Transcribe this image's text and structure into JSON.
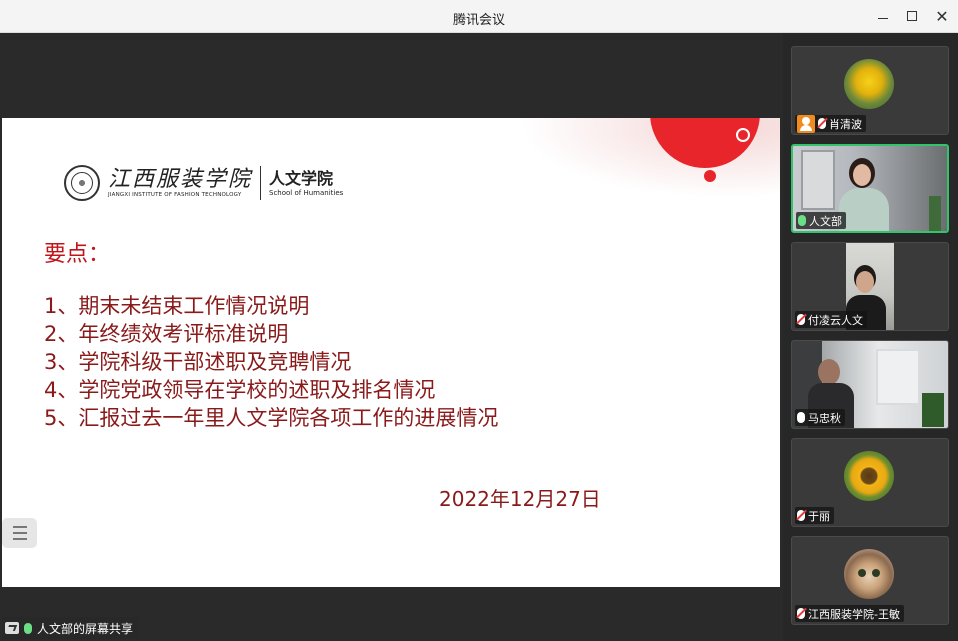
{
  "window": {
    "title": "腾讯会议"
  },
  "slide": {
    "school_name": "江西服装学院",
    "school_name_en": "JIANGXI INSTITUTE OF FASHION TECHNOLOGY",
    "department": "人文学院",
    "department_en": "School of Humanities",
    "heading": "要点：",
    "points": [
      "1、期末未结束工作情况说明",
      "2、年终绩效考评标准说明",
      "3、学院科级干部述职及竞聘情况",
      "4、学院党政领导在学校的述职及排名情况",
      "5、汇报过去一年里人文学院各项工作的进展情况"
    ],
    "date": "2022年12月27日"
  },
  "share_status": {
    "label": "人文部的屏幕共享"
  },
  "participants": [
    {
      "name": "肖清波",
      "mic": "muted",
      "host": true,
      "avatar": "dandelion-avatar"
    },
    {
      "name": "人文部",
      "mic": "on",
      "host": false,
      "avatar": "video-feed"
    },
    {
      "name": "付凌云人文",
      "mic": "muted",
      "host": false,
      "avatar": "video-feed"
    },
    {
      "name": "马忠秋",
      "mic": "off",
      "host": false,
      "avatar": "video-feed"
    },
    {
      "name": "于丽",
      "mic": "muted",
      "host": false,
      "avatar": "sunflower-avatar"
    },
    {
      "name": "江西服装学院-王敏",
      "mic": "muted",
      "host": false,
      "avatar": "cat-avatar"
    }
  ],
  "colors": {
    "accent_red": "#e8252a",
    "text_red": "#8a1a1a",
    "active_green": "#33c46b"
  }
}
